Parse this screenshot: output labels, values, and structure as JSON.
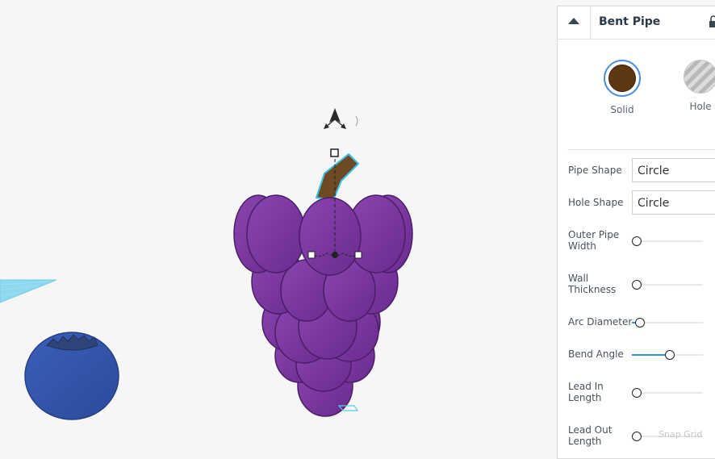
{
  "panel": {
    "title": "Bent Pipe",
    "modes": {
      "solid": "Solid",
      "hole": "Hole"
    },
    "colors": {
      "solid_swatch": "#5e3812",
      "selected_ring": "#4a8fd8",
      "accent": "#3a8ee0"
    },
    "pipe_shape": {
      "label": "Pipe Shape",
      "value": "Circle"
    },
    "hole_shape": {
      "label": "Hole Shape",
      "value": "Circle"
    },
    "sliders": [
      {
        "line1": "Outer Pipe",
        "line2": "Width",
        "fraction": 0.0
      },
      {
        "line1": "Wall",
        "line2": "Thickness",
        "fraction": 0.0
      },
      {
        "line1": "Arc Diameter",
        "line2": "",
        "fraction": 0.05
      },
      {
        "line1": "Bend Angle",
        "line2": "",
        "fraction": 0.53
      },
      {
        "line1": "Lead In",
        "line2": "Length",
        "fraction": 0.0
      },
      {
        "line1": "Lead Out",
        "line2": "Length",
        "fraction": 0.0
      }
    ]
  },
  "viewport": {
    "snap_label": "Snap Grid"
  }
}
